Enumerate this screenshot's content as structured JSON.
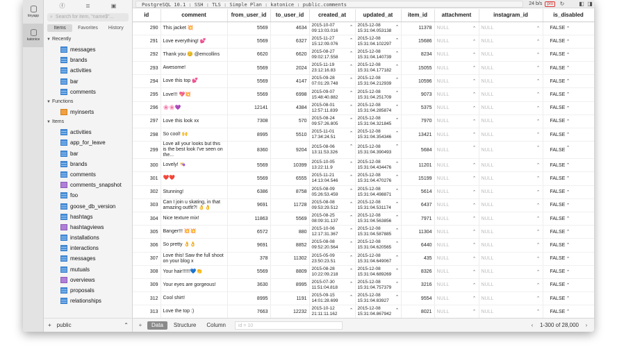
{
  "databases": [
    {
      "name": "tinyapp",
      "selected": false
    },
    {
      "name": "katonice",
      "selected": true
    }
  ],
  "connection": "PostgreSQL 10.1 : SSH : TLS : Simple Plan : katonice : public.comments",
  "speed": "24 b/s",
  "pro_badge": "pro",
  "sidebar": {
    "search_placeholder": "Search for item, \"name$\"...",
    "tabs": [
      "Items",
      "Favorites",
      "History"
    ],
    "tables_section": "Recently",
    "recent": [
      "messages",
      "brands",
      "activities",
      "bar",
      "comments"
    ],
    "functions_section": "Functions",
    "functions": [
      "myinserts"
    ],
    "items_section": "Items",
    "items": [
      {
        "n": "activities",
        "t": "t"
      },
      {
        "n": "app_for_leave",
        "t": "t"
      },
      {
        "n": "bar",
        "t": "t"
      },
      {
        "n": "brands",
        "t": "t"
      },
      {
        "n": "comments",
        "t": "t"
      },
      {
        "n": "comments_snapshot",
        "t": "v"
      },
      {
        "n": "foo",
        "t": "t"
      },
      {
        "n": "goose_db_version",
        "t": "t"
      },
      {
        "n": "hashtags",
        "t": "t"
      },
      {
        "n": "hashtagviews",
        "t": "v"
      },
      {
        "n": "installations",
        "t": "t"
      },
      {
        "n": "interactions",
        "t": "t"
      },
      {
        "n": "messages",
        "t": "t"
      },
      {
        "n": "mutuals",
        "t": "t"
      },
      {
        "n": "overviews",
        "t": "v"
      },
      {
        "n": "proposals",
        "t": "t"
      },
      {
        "n": "relationships",
        "t": "t"
      }
    ],
    "schema": "public"
  },
  "columns": [
    "id",
    "comment",
    "from_user_id",
    "to_user_id",
    "created_at",
    "updated_at",
    "item_id",
    "attachment",
    "instagram_id",
    "is_disabled"
  ],
  "rows": [
    [
      "290",
      "This jacket 💥",
      "5569",
      "4634",
      "2015-10-07 09:13:03.016",
      "2015-12-08 15:31:04.053138",
      "11378",
      "NULL",
      "NULL",
      "FALSE"
    ],
    [
      "291",
      "Love everything! 💕",
      "5569",
      "6327",
      "2015-11-27 15:12:09.076",
      "2015-12-08 15:31:04.102297",
      "15686",
      "NULL",
      "NULL",
      "FALSE"
    ],
    [
      "292",
      "Thank you 😊 @emcollins",
      "6620",
      "6620",
      "2015-08-27 09:02:17.558",
      "2015-12-08 15:31:04.140739",
      "8234",
      "NULL",
      "NULL",
      "FALSE"
    ],
    [
      "293",
      "Awesome!",
      "5569",
      "2024",
      "2015-11-19 23:12:16.83",
      "2015-12-08 15:31:04.177182",
      "15055",
      "NULL",
      "NULL",
      "FALSE"
    ],
    [
      "294",
      "Love this top 💕",
      "5569",
      "4147",
      "2015-09-28 07:01:29.748",
      "2015-12-08 15:31:04.212939",
      "10596",
      "NULL",
      "NULL",
      "FALSE"
    ],
    [
      "295",
      "Love!!! 💖💥",
      "5569",
      "6998",
      "2015-09-07 15:48:40.882",
      "2015-12-08 15:31:04.251709",
      "9073",
      "NULL",
      "NULL",
      "FALSE"
    ],
    [
      "296",
      "🌸🌸💜",
      "12141",
      "4384",
      "2015-08-01 12:57:11.839",
      "2015-12-08 15:31:04.285874",
      "5375",
      "NULL",
      "NULL",
      "FALSE"
    ],
    [
      "297",
      "Love this look xx",
      "7308",
      "570",
      "2015-08-24 09:57:26.805",
      "2015-12-08 15:31:04.321845",
      "7970",
      "NULL",
      "NULL",
      "FALSE"
    ],
    [
      "298",
      "So cool! 🙌",
      "8995",
      "5510",
      "2015-11-01 17:34:24.51",
      "2015-12-08 15:31:04.354346",
      "13421",
      "NULL",
      "NULL",
      "FALSE"
    ],
    [
      "299",
      "Love all your looks but this is the best look I've seen on the...",
      "8360",
      "9204",
      "2015-08-06 13:11:53.326",
      "2015-12-08 15:31:04.390493",
      "5684",
      "NULL",
      "NULL",
      "FALSE"
    ],
    [
      "300",
      "Lovely! 👒",
      "5569",
      "10399",
      "2015-10-05 13:22:11.9",
      "2015-12-08 15:31:04.434476",
      "11201",
      "NULL",
      "NULL",
      "FALSE"
    ],
    [
      "301",
      "❤️❤️",
      "5569",
      "6555",
      "2015-11-21 14:13:04.546",
      "2015-12-08 15:31:04.470276",
      "15199",
      "NULL",
      "NULL",
      "FALSE"
    ],
    [
      "302",
      "Stunning!",
      "6386",
      "8758",
      "2015-08-09 05:26:53.459",
      "2015-12-08 15:31:04.498871",
      "5614",
      "NULL",
      "NULL",
      "FALSE"
    ],
    [
      "303",
      "Can I join u skating, in that amazing outfit?! 👌👌",
      "9691",
      "11728",
      "2015-08-08 09:53:29.512",
      "2015-12-08 15:31:04.531174",
      "6437",
      "NULL",
      "NULL",
      "FALSE"
    ],
    [
      "304",
      "Nice texture mix!",
      "11863",
      "5569",
      "2015-08-25 08:09:31.137",
      "2015-12-08 15:31:04.563856",
      "7971",
      "NULL",
      "NULL",
      "FALSE"
    ],
    [
      "305",
      "Banger!!! 💥💥",
      "6572",
      "880",
      "2015-10-06 12:17:31.367",
      "2015-12-08 15:31:04.587885",
      "11304",
      "NULL",
      "NULL",
      "FALSE"
    ],
    [
      "306",
      "So pretty 👌👌",
      "9691",
      "8852",
      "2015-08-08 09:52:20.564",
      "2015-12-08 15:31:04.620565",
      "6440",
      "NULL",
      "NULL",
      "FALSE"
    ],
    [
      "307",
      "Love this! Saw the full shoot on your blog x",
      "378",
      "11302",
      "2015-05-09 23:50:23.51",
      "2015-12-08 15:31:04.649067",
      "435",
      "NULL",
      "NULL",
      "FALSE"
    ],
    [
      "308",
      "Your hair!!!!!!💙👏",
      "5569",
      "8809",
      "2015-08-28 10:22:09.218",
      "2015-12-08 15:31:04.689269",
      "8326",
      "NULL",
      "NULL",
      "FALSE"
    ],
    [
      "309",
      "Your eyes are gorgeous!",
      "3630",
      "8995",
      "2015-07-30 11:51:04.818",
      "2015-12-08 15:31:04.757379",
      "3216",
      "NULL",
      "NULL",
      "FALSE"
    ],
    [
      "312",
      "Cool shirt!",
      "8995",
      "1191",
      "2015-09-15 14:01:28.699",
      "2015-12-08 15:31:04.83927",
      "9554",
      "NULL",
      "NULL",
      "FALSE"
    ],
    [
      "313",
      "Love the top :)",
      "7663",
      "12232",
      "2015-10-12 21:11:11.162",
      "2015-12-08 15:31:04.867942",
      "8021",
      "NULL",
      "NULL",
      "FALSE"
    ]
  ],
  "footer": {
    "tabs": [
      "Data",
      "Structure",
      "Column"
    ],
    "filter_placeholder": "id = 10",
    "range": "1-300 of 28,000"
  }
}
